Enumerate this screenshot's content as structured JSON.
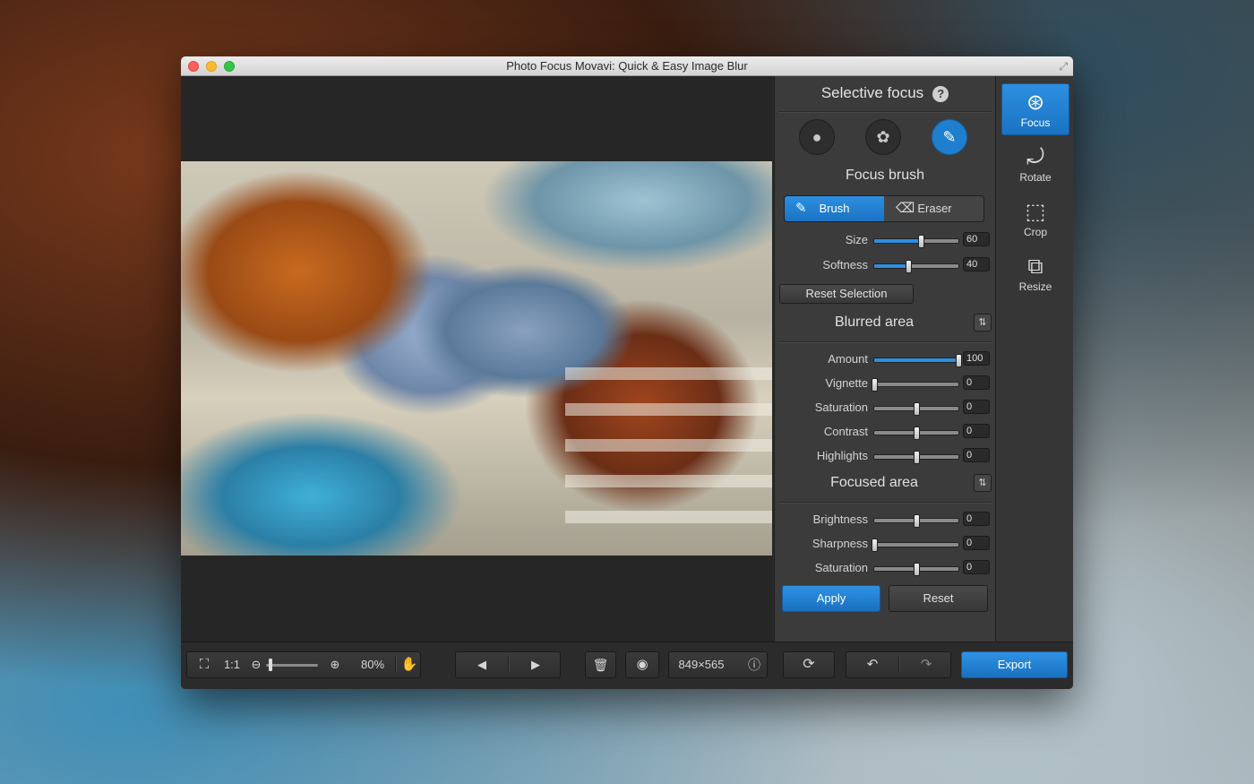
{
  "window": {
    "title": "Photo Focus Movavi: Quick & Easy Image Blur"
  },
  "panel": {
    "title": "Selective focus",
    "help_icon": "?",
    "mode_icons": [
      "person-icon",
      "flower-icon",
      "brush-icon"
    ],
    "active_mode": "brush-icon",
    "mode_title": "Focus brush",
    "brush_label": "Brush",
    "eraser_label": "Eraser",
    "active_tool": "Brush",
    "brush_settings": [
      {
        "label": "Size",
        "value": "60",
        "level": 0.55
      },
      {
        "label": "Softness",
        "value": "40",
        "level": 0.4
      }
    ],
    "reset_selection": "Reset Selection",
    "blurred_title": "Blurred area",
    "blurred_settings": [
      {
        "label": "Amount",
        "value": "100",
        "level": 1.0,
        "filled": true
      },
      {
        "label": "Vignette",
        "value": "0",
        "level": 0.0
      },
      {
        "label": "Saturation",
        "value": "0",
        "level": 0.5
      },
      {
        "label": "Contrast",
        "value": "0",
        "level": 0.5
      },
      {
        "label": "Highlights",
        "value": "0",
        "level": 0.5
      }
    ],
    "focused_title": "Focused area",
    "focused_settings": [
      {
        "label": "Brightness",
        "value": "0",
        "level": 0.5
      },
      {
        "label": "Sharpness",
        "value": "0",
        "level": 0.0
      },
      {
        "label": "Saturation",
        "value": "0",
        "level": 0.5
      }
    ],
    "apply_label": "Apply",
    "reset_label": "Reset"
  },
  "tools": [
    {
      "label": "Focus",
      "icon": "aperture-icon",
      "active": true
    },
    {
      "label": "Rotate",
      "icon": "rotate-icon",
      "active": false
    },
    {
      "label": "Crop",
      "icon": "crop-icon",
      "active": false
    },
    {
      "label": "Resize",
      "icon": "resize-icon",
      "active": false
    }
  ],
  "bottombar": {
    "ratio_label": "1:1",
    "zoom_value": "80%",
    "zoom_level": 0.05,
    "image_size": "849×565",
    "export_label": "Export"
  },
  "colors": {
    "accent": "#1f7fcf",
    "panel": "#3b3b3b",
    "canvas": "#262626"
  }
}
